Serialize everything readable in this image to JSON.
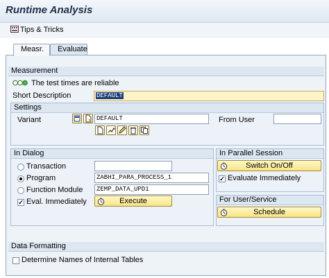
{
  "window": {
    "title": "Runtime Analysis"
  },
  "toolbar": {
    "tips_label": "Tips & Tricks"
  },
  "tabs": [
    {
      "label": "Measr."
    },
    {
      "label": "Evaluate"
    }
  ],
  "measurement": {
    "heading": "Measurement",
    "status_text": "The test times are reliable",
    "short_desc_label": "Short Description",
    "short_desc_value": "DEFAULT"
  },
  "settings": {
    "heading": "Settings",
    "variant_label": "Variant",
    "variant_value": "DEFAULT",
    "from_user_label": "From User",
    "from_user_value": ""
  },
  "in_dialog": {
    "heading": "In Dialog",
    "transaction_label": "Transaction",
    "transaction_value": "",
    "program_label": "Program",
    "program_value": "ZABHI_PARA_PROCESS_1",
    "function_label": "Function Module",
    "function_value": "ZEMP_DATA_UPD1",
    "eval_label": "Eval. Immediately",
    "execute_label": "Execute"
  },
  "parallel": {
    "heading": "In Parallel Session",
    "switch_label": "Switch On/Off",
    "eval_label": "Evaluate Immediately"
  },
  "user_service": {
    "heading": "For User/Service",
    "schedule_label": "Schedule"
  },
  "data_formatting": {
    "heading": "Data Formatting",
    "determine_label": "Determine Names of Internal Tables"
  }
}
